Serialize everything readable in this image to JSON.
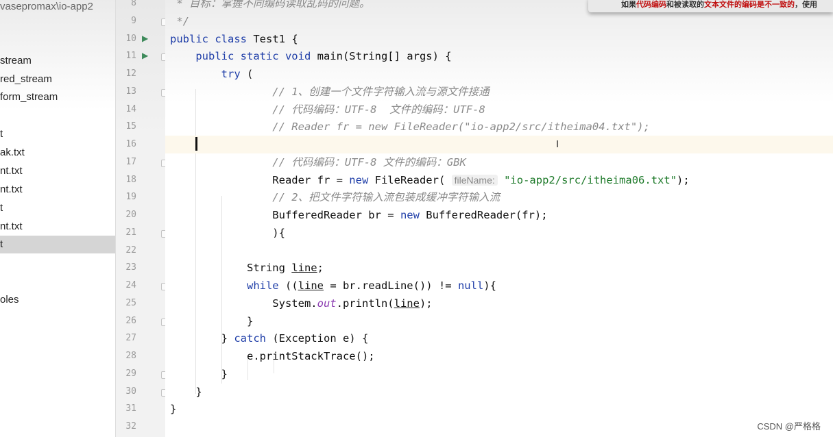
{
  "sidebar": {
    "path": "vasepromax\\io-app2",
    "items": [
      "stream",
      "red_stream",
      "form_stream",
      "t",
      "ak.txt",
      "nt.txt",
      "nt.txt",
      "t",
      "nt.txt",
      "t",
      "oles"
    ],
    "selected_index": 9
  },
  "popup": {
    "parts": [
      [
        "如果",
        ""
      ],
      [
        "代码编码",
        "r"
      ],
      [
        "和被读取的",
        ""
      ],
      [
        "文本文件的编码是不一致的",
        "r"
      ],
      [
        "，使用",
        ""
      ]
    ]
  },
  "watermark": "CSDN @严格格",
  "editor": {
    "first_line": 8,
    "current_line": 16,
    "run_lines": [
      10,
      11
    ],
    "fold_lines": [
      9,
      11,
      13,
      17,
      21,
      24,
      26,
      29,
      30
    ],
    "lines": [
      [
        [
          " * 目标：掌握不同编码读取乱码的问题。",
          "cm"
        ]
      ],
      [
        [
          " */",
          "cm"
        ]
      ],
      [
        [
          "public class ",
          "kw"
        ],
        [
          "Test1 {",
          ""
        ]
      ],
      [
        [
          "    public static void ",
          "kw"
        ],
        [
          "main(String[] args) {",
          ""
        ]
      ],
      [
        [
          "        try ",
          "kw"
        ],
        [
          "(",
          ""
        ]
      ],
      [
        [
          "                // 1、创建一个文件字符输入流与源文件接通",
          "cm"
        ]
      ],
      [
        [
          "                // 代码编码：UTF-8  文件的编码：UTF-8",
          "cm"
        ]
      ],
      [
        [
          "                // Reader fr = new FileReader(\"io-app2/src/itheima04.txt\");",
          "cm"
        ]
      ],
      [
        [
          "",
          ""
        ]
      ],
      [
        [
          "                // 代码编码：UTF-8 文件的编码：GBK",
          "cm"
        ]
      ],
      [
        [
          "                Reader fr = ",
          ""
        ],
        [
          "new ",
          "kw"
        ],
        [
          "FileReader( ",
          ""
        ],
        [
          "fileName:",
          "hint"
        ],
        [
          " \"io-app2/src/itheima06.txt\"",
          "str"
        ],
        [
          ");",
          ""
        ]
      ],
      [
        [
          "                // 2、把文件字符输入流包装成缓冲字符输入流",
          "cm"
        ]
      ],
      [
        [
          "                BufferedReader br = ",
          ""
        ],
        [
          "new ",
          "kw"
        ],
        [
          "BufferedReader(fr);",
          ""
        ]
      ],
      [
        [
          "                ){",
          ""
        ]
      ],
      [
        [
          "",
          ""
        ]
      ],
      [
        [
          "            String ",
          ""
        ],
        [
          "line",
          "u"
        ],
        [
          ";",
          ""
        ]
      ],
      [
        [
          "            while ",
          "kw"
        ],
        [
          "((",
          ""
        ],
        [
          "line",
          "u"
        ],
        [
          " = br.readLine()) != ",
          ""
        ],
        [
          "null",
          "kw"
        ],
        [
          "){",
          ""
        ]
      ],
      [
        [
          "                System.",
          ""
        ],
        [
          "out",
          "fld"
        ],
        [
          ".println(",
          ""
        ],
        [
          "line",
          "u"
        ],
        [
          ");",
          ""
        ]
      ],
      [
        [
          "            }",
          ""
        ]
      ],
      [
        [
          "        } ",
          ""
        ],
        [
          "catch ",
          "kw"
        ],
        [
          "(Exception e) {",
          ""
        ]
      ],
      [
        [
          "            e.printStackTrace();",
          ""
        ]
      ],
      [
        [
          "        }",
          ""
        ]
      ],
      [
        [
          "    }",
          ""
        ]
      ],
      [
        [
          "}",
          ""
        ]
      ],
      [
        [
          "",
          ""
        ]
      ]
    ]
  }
}
